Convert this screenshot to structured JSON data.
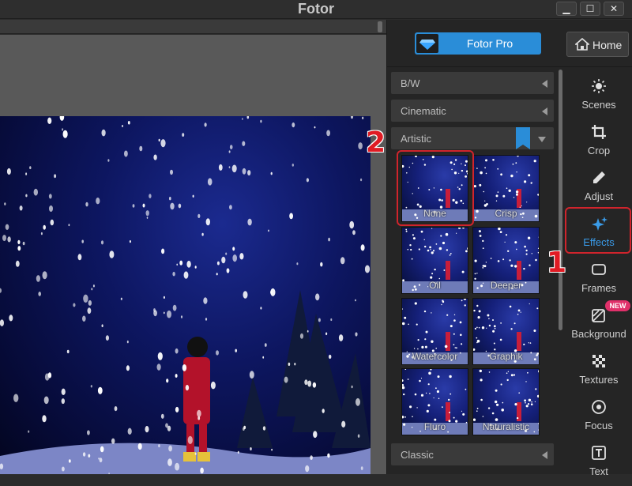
{
  "window": {
    "title": "Fotor",
    "min": "▁",
    "max": "☐",
    "close": "✕"
  },
  "header": {
    "pro_label": "Fotor Pro",
    "home_label": "Home"
  },
  "effects": {
    "categories": [
      {
        "label": "B/W"
      },
      {
        "label": "Cinematic"
      },
      {
        "label": "Artistic"
      },
      {
        "label": "Classic"
      }
    ],
    "artistic_thumbs": [
      {
        "label": "None"
      },
      {
        "label": "Crisp"
      },
      {
        "label": "Oil"
      },
      {
        "label": "Deeper"
      },
      {
        "label": "Watercolor"
      },
      {
        "label": "Graphik"
      },
      {
        "label": "Fluro"
      },
      {
        "label": "Naturalistic"
      }
    ]
  },
  "tools": [
    {
      "label": "Scenes"
    },
    {
      "label": "Crop"
    },
    {
      "label": "Adjust"
    },
    {
      "label": "Effects"
    },
    {
      "label": "Frames"
    },
    {
      "label": "Background"
    },
    {
      "label": "Textures"
    },
    {
      "label": "Focus"
    },
    {
      "label": "Text"
    }
  ],
  "badges": {
    "new": "NEW"
  },
  "annotations": {
    "step1": "1",
    "step2": "2"
  },
  "colors": {
    "accent": "#2a8dd8",
    "highlight": "#d0242c",
    "active_tool": "#3a9be8"
  }
}
